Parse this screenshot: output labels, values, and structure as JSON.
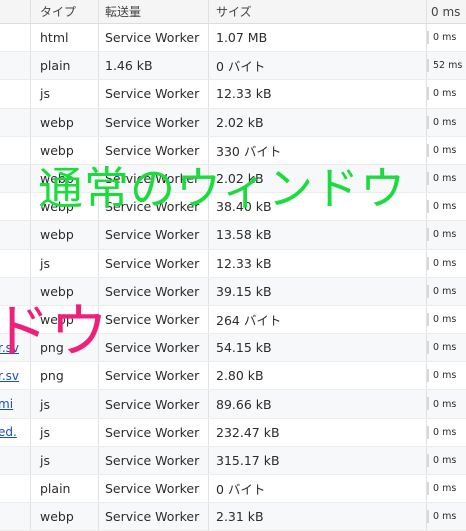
{
  "columns": {
    "type": "タイプ",
    "transferred": "転送量",
    "size": "サイズ",
    "time": "0 ms"
  },
  "rows": [
    {
      "name": "",
      "type": "html",
      "transferred": "Service Worker",
      "size": "1.07 MB",
      "time": "0 ms"
    },
    {
      "name": "",
      "type": "plain",
      "transferred": "1.46 kB",
      "size": "0 バイト",
      "time": "52 ms"
    },
    {
      "name": "",
      "type": "js",
      "transferred": "Service Worker",
      "size": "12.33 kB",
      "time": "0 ms"
    },
    {
      "name": "",
      "type": "webp",
      "transferred": "Service Worker",
      "size": "2.02 kB",
      "time": "0 ms"
    },
    {
      "name": "",
      "type": "webp",
      "transferred": "Service Worker",
      "size": "330 バイト",
      "time": "0 ms"
    },
    {
      "name": "",
      "type": "webp",
      "transferred": "Service Worker",
      "size": "2.02 kB",
      "time": "0 ms"
    },
    {
      "name": "",
      "type": "webp",
      "transferred": "Service Worker",
      "size": "38.40 kB",
      "time": "0 ms"
    },
    {
      "name": "",
      "type": "webp",
      "transferred": "Service Worker",
      "size": "13.58 kB",
      "time": "0 ms"
    },
    {
      "name": "",
      "type": "js",
      "transferred": "Service Worker",
      "size": "12.33 kB",
      "time": "0 ms"
    },
    {
      "name": "",
      "type": "webp",
      "transferred": "Service Worker",
      "size": "39.15 kB",
      "time": "0 ms"
    },
    {
      "name": "",
      "type": "webp",
      "transferred": "Service Worker",
      "size": "264 バイト",
      "time": "0 ms"
    },
    {
      "name": "r.sv",
      "type": "png",
      "transferred": "Service Worker",
      "size": "54.15 kB",
      "time": "0 ms"
    },
    {
      "name": "r.sv",
      "type": "png",
      "transferred": "Service Worker",
      "size": "2.80 kB",
      "time": "0 ms"
    },
    {
      "name": "mi",
      "type": "js",
      "transferred": "Service Worker",
      "size": "89.66 kB",
      "time": "0 ms"
    },
    {
      "name": "ed.",
      "type": "js",
      "transferred": "Service Worker",
      "size": "232.47 kB",
      "time": "0 ms"
    },
    {
      "name": "",
      "type": "js",
      "transferred": "Service Worker",
      "size": "315.17 kB",
      "time": "0 ms"
    },
    {
      "name": "",
      "type": "plain",
      "transferred": "Service Worker",
      "size": "0 バイト",
      "time": "0 ms"
    },
    {
      "name": "",
      "type": "webp",
      "transferred": "Service Worker",
      "size": "2.31 kB",
      "time": "0 ms"
    }
  ],
  "overlay": {
    "green_text": "通常のウィンドウ",
    "pink_text": "ドウ",
    "green_color": "#1bdc3d",
    "pink_color": "#ef1f7a"
  }
}
